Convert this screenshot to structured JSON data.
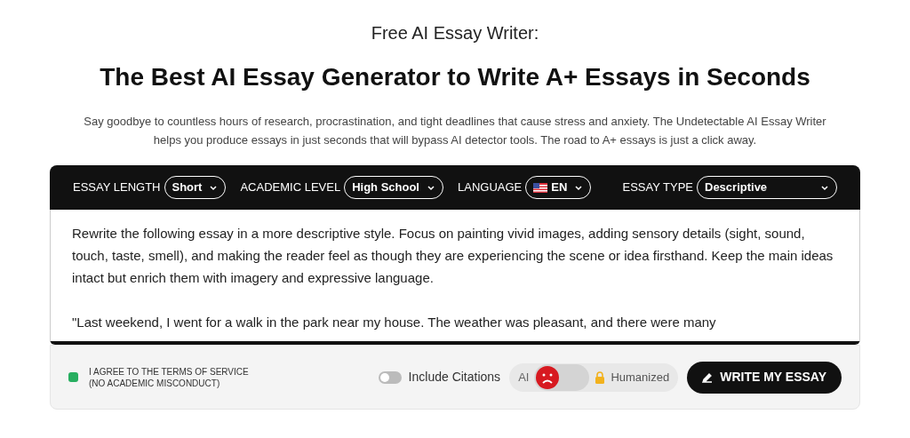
{
  "eyebrow": "Free AI Essay Writer:",
  "title": "The Best AI Essay Generator to Write A+ Essays in Seconds",
  "description": "Say goodbye to countless hours of research, procrastination, and tight deadlines that cause stress and anxiety. The Undetectable AI Essay Writer helps you produce essays in just seconds that will bypass AI detector tools. The road to A+ essays is just a click away.",
  "toolbar": [
    {
      "label": "ESSAY LENGTH",
      "value": "Short",
      "kind": "plain"
    },
    {
      "label": "ACADEMIC LEVEL",
      "value": "High School",
      "kind": "plain"
    },
    {
      "label": "LANGUAGE",
      "value": "EN",
      "kind": "flag"
    },
    {
      "label": "ESSAY TYPE",
      "value": "Descriptive",
      "kind": "wide"
    }
  ],
  "prompt": [
    "Rewrite the following essay in a more descriptive style. Focus on painting vivid images, adding sensory details (sight, sound, touch, taste, smell), and making the reader feel as though they are experiencing the scene or idea firsthand. Keep the main ideas intact but enrich them with imagery and expressive language.",
    "\"Last weekend, I went for a walk in the park near my house. The weather was pleasant, and there were many"
  ],
  "footer": {
    "agree": {
      "lines": [
        "I AGREE TO THE TERMS OF SERVICE",
        "(NO ACADEMIC MISCONDUCT)"
      ],
      "checked": true
    },
    "citations": {
      "label": "Include Citations",
      "on": false
    },
    "mode": {
      "left": "AI",
      "right": "Humanized",
      "humanized": false
    },
    "submit": "WRITE MY ESSAY"
  }
}
